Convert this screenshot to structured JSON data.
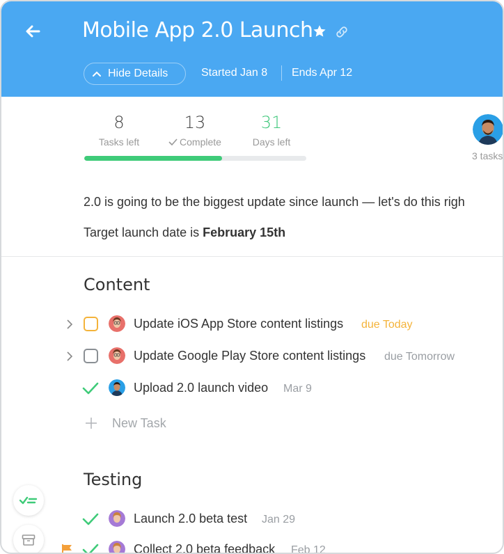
{
  "header": {
    "title": "Mobile App 2.0 Launch",
    "hide_details_label": "Hide Details",
    "started": "Started Jan 8",
    "ends": "Ends Apr 12",
    "bg_color": "#4aa8f2"
  },
  "stats": {
    "tasks_left": {
      "value": "8",
      "label": "Tasks left"
    },
    "complete": {
      "value": "13",
      "label": "Complete"
    },
    "days_left": {
      "value": "31",
      "label": "Days left"
    },
    "progress_fraction": 0.62
  },
  "assignee": {
    "tasks_label": "3 tasks"
  },
  "description": {
    "line1": "2.0 is going to be the biggest update since launch — let's do this righ",
    "line2_prefix": "Target launch date is ",
    "line2_bold": "February 15th"
  },
  "sections": [
    {
      "title": "Content",
      "tasks": [
        {
          "name": "Update iOS App Store content listings",
          "due": "due Today",
          "status": "open",
          "due_color": "#f4b33a"
        },
        {
          "name": "Update Google Play Store content listings",
          "due": "due Tomorrow",
          "status": "open"
        },
        {
          "name": "Upload 2.0 launch video",
          "due": "Mar 9",
          "status": "done"
        }
      ],
      "new_task_label": "New Task"
    },
    {
      "title": "Testing",
      "tasks": [
        {
          "name": "Launch 2.0 beta test",
          "due": "Jan 29",
          "status": "done"
        },
        {
          "name": "Collect 2.0 beta feedback",
          "due": "Feb 12",
          "status": "done"
        }
      ]
    }
  ],
  "icons": [
    "back-arrow-icon",
    "star-icon",
    "link-icon",
    "chevron-up-icon",
    "chevron-right-icon",
    "checkmark-icon",
    "plus-icon",
    "tasks-icon",
    "archive-icon",
    "flag-icon"
  ]
}
